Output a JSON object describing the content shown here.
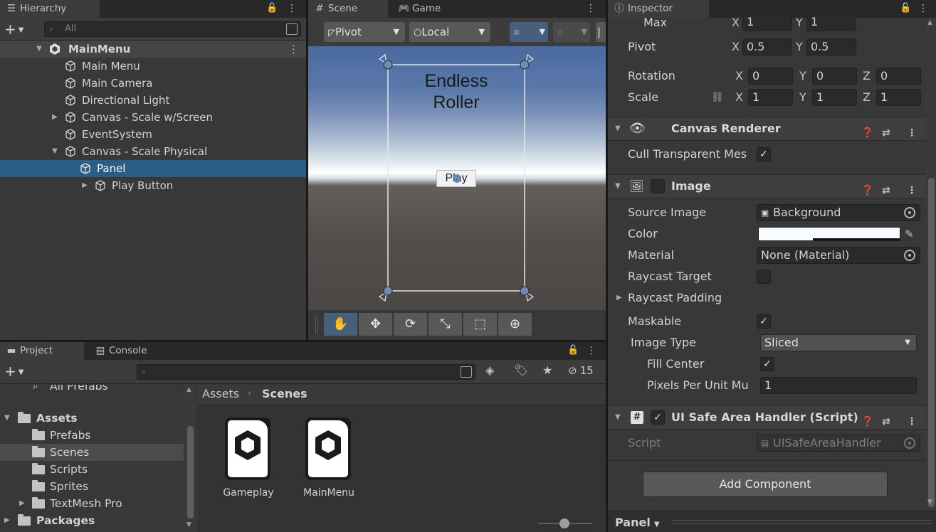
{
  "hierarchy": {
    "tab_label": "Hierarchy",
    "add_label": "+",
    "search_placeholder": "All",
    "root": "MainMenu",
    "items": [
      {
        "label": "Main Menu"
      },
      {
        "label": "Main Camera"
      },
      {
        "label": "Directional Light"
      },
      {
        "label": "Canvas - Scale w/Screen"
      },
      {
        "label": "EventSystem"
      },
      {
        "label": "Canvas - Scale Physical"
      },
      {
        "label": "Panel"
      },
      {
        "label": "Play Button"
      }
    ]
  },
  "scene": {
    "tabs": [
      "Scene",
      "Game"
    ],
    "pivot_label": "Pivot",
    "local_label": "Local",
    "ui_title": "Endless Roller",
    "play_button": "Play"
  },
  "project": {
    "tabs": [
      "Project",
      "Console"
    ],
    "add_label": "+",
    "hidden_count": "15",
    "favorites_partial": "All Prefabs",
    "root": "Assets",
    "folders": [
      "Prefabs",
      "Scenes",
      "Scripts",
      "Sprites",
      "TextMesh Pro"
    ],
    "packages": "Packages",
    "breadcrumb": [
      "Assets",
      "Scenes"
    ],
    "assets": [
      "Gameplay",
      "MainMenu"
    ]
  },
  "inspector": {
    "tab_label": "Inspector",
    "max_label": "Max",
    "max_x": "1",
    "max_y": "1",
    "pivot_label": "Pivot",
    "pivot_x": "0.5",
    "pivot_y": "0.5",
    "rotation_label": "Rotation",
    "rotation": [
      "0",
      "0",
      "0"
    ],
    "scale_label": "Scale",
    "scale": [
      "1",
      "1",
      "1"
    ],
    "axes": [
      "X",
      "Y",
      "Z"
    ],
    "canvas_renderer": {
      "title": "Canvas Renderer",
      "cull_label": "Cull Transparent Mes"
    },
    "image": {
      "title": "Image",
      "source_image_label": "Source Image",
      "source_image": "Background",
      "color_label": "Color",
      "material_label": "Material",
      "material": "None (Material)",
      "raycast_target_label": "Raycast Target",
      "raycast_padding_label": "Raycast Padding",
      "maskable_label": "Maskable",
      "image_type_label": "Image Type",
      "image_type": "Sliced",
      "fill_center_label": "Fill Center",
      "ppu_label": "Pixels Per Unit Mu",
      "ppu_value": "1"
    },
    "safe_area": {
      "title": "UI Safe Area Handler (Script)",
      "script_label": "Script",
      "script_value": "UISafeAreaHandler"
    },
    "add_component": "Add Component",
    "preview_label": "Panel"
  }
}
